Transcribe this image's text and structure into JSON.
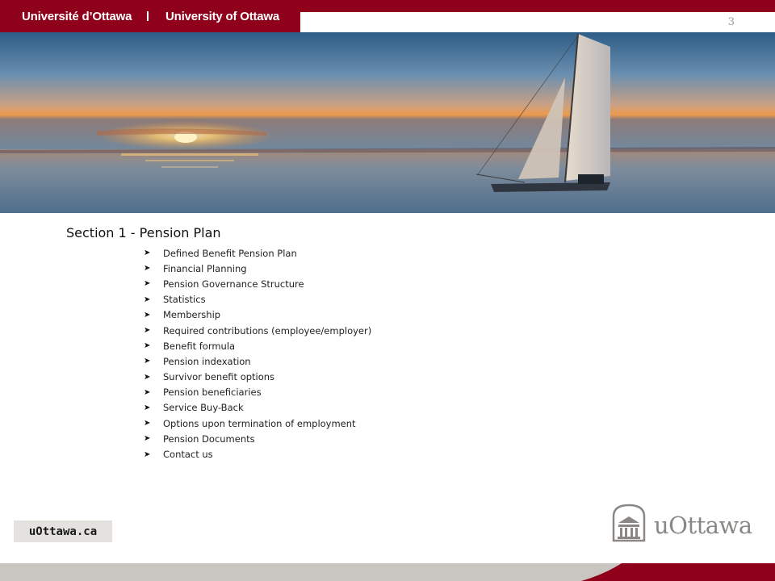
{
  "header": {
    "university_fr": "Université d’Ottawa",
    "university_en": "University of Ottawa",
    "page_number": "3"
  },
  "section": {
    "title": "Section 1 - Pension Plan",
    "items": [
      "Defined Benefit Pension Plan",
      "Financial Planning",
      "Pension Governance Structure",
      "Statistics",
      "Membership",
      "Required contributions  (employee/employer)",
      "Benefit formula",
      "Pension indexation",
      "Survivor benefit options",
      "Pension beneficiaries",
      "Service Buy-Back",
      "Options  upon termination  of employment",
      "Pension Documents",
      "Contact us"
    ]
  },
  "footer": {
    "url": "uOttawa.ca",
    "logo_text": "uOttawa"
  },
  "colors": {
    "brand_red": "#8f001a",
    "footer_grey": "#c9c5c1"
  }
}
